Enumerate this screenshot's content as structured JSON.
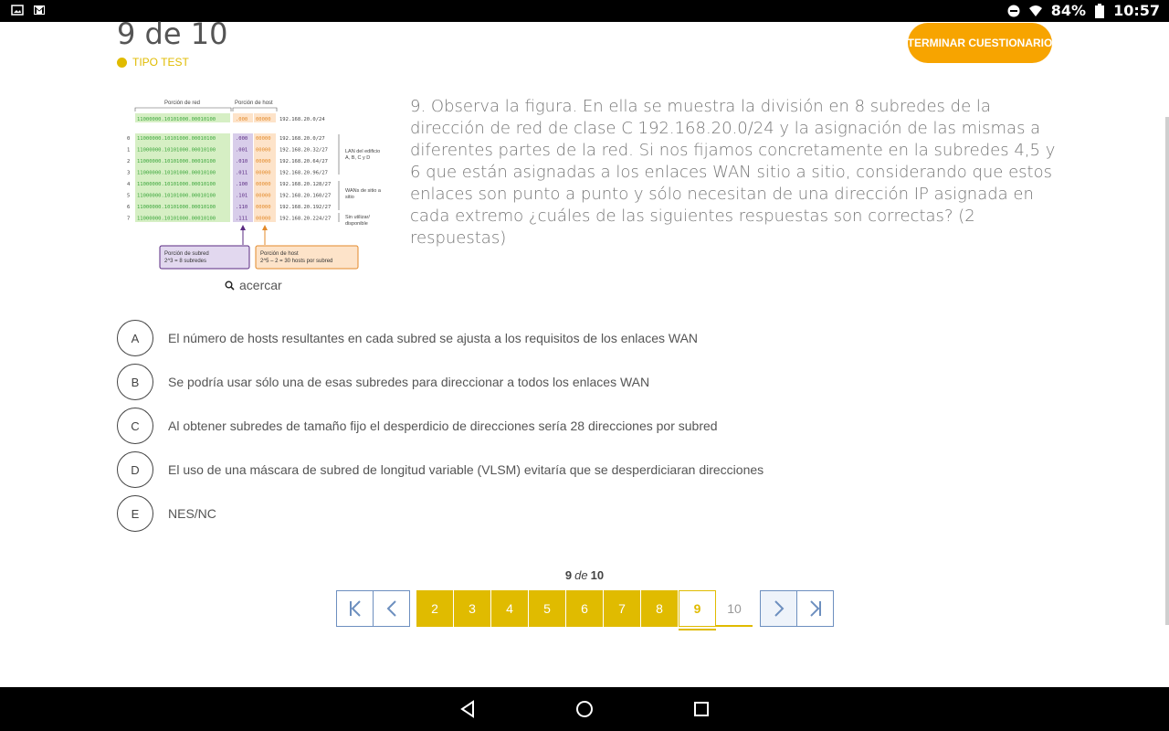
{
  "status": {
    "battery": "84%",
    "time": "10:57"
  },
  "header": {
    "counter": "9 de 10",
    "test_type": "TIPO TEST",
    "finish_label": "TERMINAR CUESTIONARIO"
  },
  "figure": {
    "label_network": "Porción de red",
    "label_host": "Porción de host",
    "top_row": {
      "net": "11000000.10101000.00010100",
      "sub": ".000",
      "host": "00000",
      "addr": "192.168.20.0/24"
    },
    "rows": [
      {
        "n": "0",
        "net": "11000000.10101000.00010100",
        "sub": ".000",
        "host": "00000",
        "addr": "192.168.20.0/27"
      },
      {
        "n": "1",
        "net": "11000000.10101000.00010100",
        "sub": ".001",
        "host": "00000",
        "addr": "192.168.20.32/27"
      },
      {
        "n": "2",
        "net": "11000000.10101000.00010100",
        "sub": ".010",
        "host": "00000",
        "addr": "192.168.20.64/27"
      },
      {
        "n": "3",
        "net": "11000000.10101000.00010100",
        "sub": ".011",
        "host": "00000",
        "addr": "192.168.20.96/27"
      },
      {
        "n": "4",
        "net": "11000000.10101000.00010100",
        "sub": ".100",
        "host": "00000",
        "addr": "192.168.20.128/27"
      },
      {
        "n": "5",
        "net": "11000000.10101000.00010100",
        "sub": ".101",
        "host": "00000",
        "addr": "192.168.20.160/27"
      },
      {
        "n": "6",
        "net": "11000000.10101000.00010100",
        "sub": ".110",
        "host": "00000",
        "addr": "192.168.20.192/27"
      },
      {
        "n": "7",
        "net": "11000000.10101000.00010100",
        "sub": ".111",
        "host": "00000",
        "addr": "192.168.20.224/27"
      }
    ],
    "group_lan": [
      "LAN del edificio",
      "A, B, C y D"
    ],
    "group_wan": [
      "WANs de sitio a",
      "sitio"
    ],
    "group_unused": [
      "Sin utilizar/",
      "disponible"
    ],
    "box_subnet": [
      "Porción de subred",
      "2^3 = 8 subredes"
    ],
    "box_host": [
      "Porción de host",
      "2^5 – 2 = 30 hosts por subred"
    ],
    "zoom_label": "acercar"
  },
  "question": "9. Observa la figura. En ella se muestra la división en 8 subredes de la dirección de red de clase C 192.168.20.0/24 y la asignación de las mismas a diferentes partes de la red. Si nos fijamos concretamente en la subredes 4,5 y 6 que están asignadas a los enlaces WAN sitio a sitio, considerando que estos enlaces son punto a punto y sólo necesitan de una dirección IP asignada en cada extremo ¿cuáles de las siguientes respuestas son correctas? (2 respuestas)",
  "answers": [
    {
      "letter": "A",
      "text": "El número de hosts resultantes en cada subred se ajusta a los requisitos de los enlaces WAN"
    },
    {
      "letter": "B",
      "text": "Se podría usar sólo una de esas subredes para direccionar a todos los enlaces WAN"
    },
    {
      "letter": "C",
      "text": "Al obtener subredes de tamaño fijo el desperdicio de direcciones sería 28 direcciones por subred"
    },
    {
      "letter": "D",
      "text": "El uso de una máscara de subred de longitud variable (VLSM) evitaría que se desperdiciaran direcciones"
    },
    {
      "letter": "E",
      "text": "NES/NC"
    }
  ],
  "pager": {
    "current": "9",
    "of": "de",
    "total": "10",
    "pages": [
      "2",
      "3",
      "4",
      "5",
      "6",
      "7",
      "8",
      "9",
      "10"
    ]
  },
  "colors": {
    "accent": "#e0bb00",
    "finish": "#f7a400",
    "pager_border": "#6d8fbf"
  }
}
